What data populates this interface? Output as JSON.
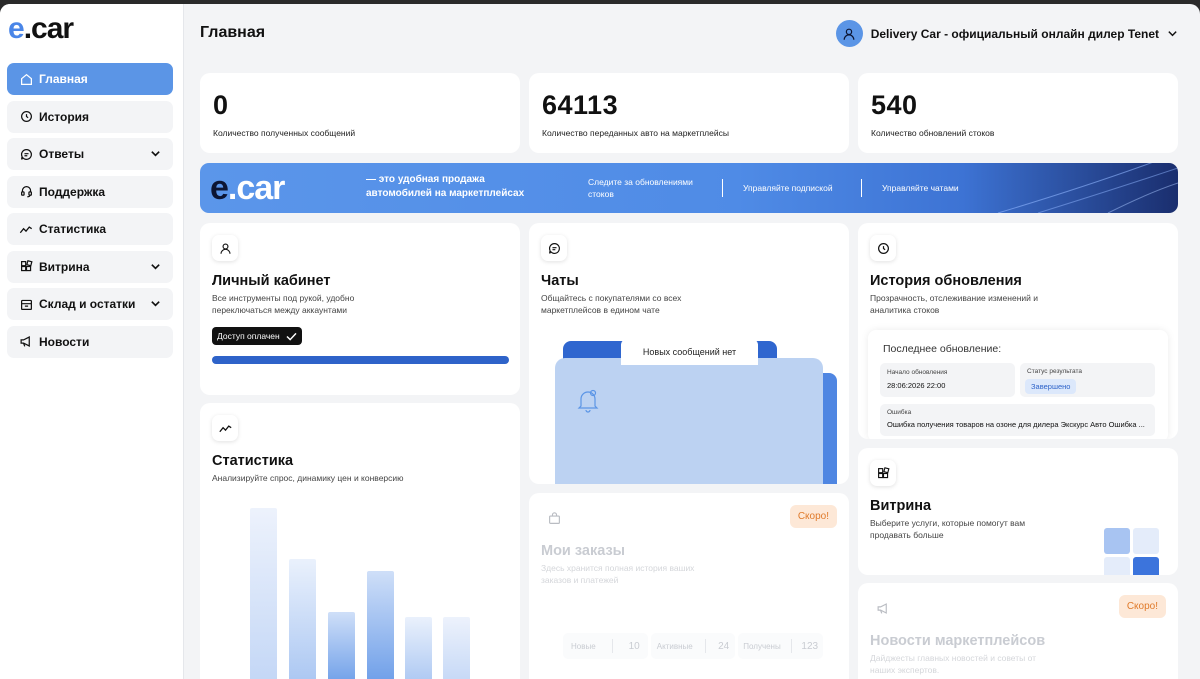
{
  "brand": {
    "logo_e": "e",
    "logo_rest": ".car"
  },
  "sidebar": {
    "items": [
      {
        "label": "Главная"
      },
      {
        "label": "История"
      },
      {
        "label": "Ответы"
      },
      {
        "label": "Поддержка"
      },
      {
        "label": "Статистика"
      },
      {
        "label": "Витрина"
      },
      {
        "label": "Склад и остатки"
      },
      {
        "label": "Новости"
      }
    ]
  },
  "header": {
    "title": "Главная",
    "user_name": "Delivery Car - официальный онлайн дилер Tenet"
  },
  "stats": [
    {
      "value": "0",
      "label": "Количество полученных сообщений"
    },
    {
      "value": "64113",
      "label": "Количество переданных авто на маркетплейсы"
    },
    {
      "value": "540",
      "label": "Количество обновлений стоков"
    }
  ],
  "banner": {
    "tagline": "— это удобная продажа автомобилей на маркетплейсах",
    "link1": "Следите за обновлениями стоков",
    "link2": "Управляйте подпиской",
    "link3": "Управляйте чатами"
  },
  "cabinet": {
    "title": "Личный кабинет",
    "desc": "Все инструменты под рукой, удобно переключаться между аккаунтами",
    "badge": "Доступ оплачен",
    "progress": 1.0
  },
  "chats": {
    "title": "Чаты",
    "desc": "Общайтесь с покупателями со всех маркетплейсов в едином чате",
    "tab_label": "Новых сообщений нет"
  },
  "history": {
    "title": "История обновления",
    "desc": "Прозрачность, отслеживание изменений и аналитика стоков",
    "panel_title": "Последнее обновление:",
    "start_label": "Начало обновления",
    "start_value": "28:06:2026 22:00",
    "status_label": "Статус результата",
    "status_value": "Завершено",
    "error_label": "Ошибка",
    "error_value": "Ошибка получения товаров на озоне для дилера Экскурс Авто Ошибка ..."
  },
  "statistics": {
    "title": "Статистика",
    "desc": "Анализируйте спрос, динамику цен и конверсию"
  },
  "orders": {
    "title": "Мои заказы",
    "desc": "Здесь хранится полная история ваших заказов и платежей",
    "soon": "Скоро!",
    "filters": [
      {
        "label": "Новые",
        "count": "10"
      },
      {
        "label": "Активные",
        "count": "24"
      },
      {
        "label": "Получены",
        "count": "123"
      }
    ]
  },
  "showcase": {
    "title": "Витрина",
    "desc": "Выберите услуги, которые помогут вам продавать больше"
  },
  "news": {
    "title": "Новости маркетплейсов",
    "desc": "Дайджесты главных новостей и советы от наших экспертов.",
    "soon": "Скоро!"
  },
  "colors": {
    "accent": "#5b95e6",
    "dark": "#0c1533",
    "soon_bg": "#fde8d7",
    "soon_text": "#e07b2b"
  }
}
